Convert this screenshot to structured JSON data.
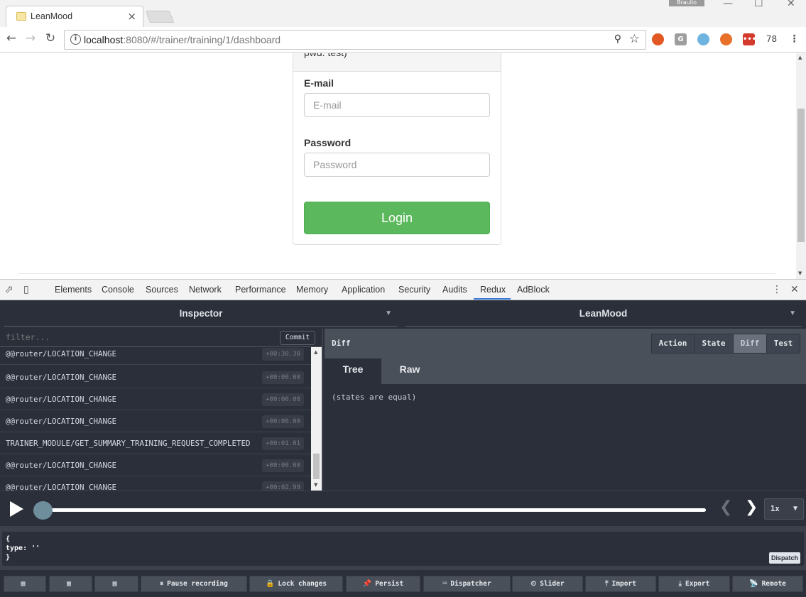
{
  "browser": {
    "tab_title": "LeanMood",
    "tab_close": "×",
    "user_badge": "Braulio",
    "url_host": "localhost",
    "url_rest": ":8080/#/trainer/training/1/dashboard",
    "ext_count": "78",
    "window_controls": [
      "—",
      "☐",
      "✕"
    ]
  },
  "page": {
    "card_header": "pwd: test)",
    "email_label": "E-mail",
    "email_placeholder": "E-mail",
    "password_label": "Password",
    "password_placeholder": "Password",
    "login_label": "Login"
  },
  "devtools": {
    "tabs": [
      "Elements",
      "Console",
      "Sources",
      "Network",
      "Performance",
      "Memory",
      "Application",
      "Security",
      "Audits",
      "Redux",
      "AdBlock"
    ],
    "active_tab": "Redux"
  },
  "redux": {
    "monitor": "Inspector",
    "instance": "LeanMood",
    "filter_placeholder": "filter...",
    "commit_label": "Commit",
    "actions": [
      {
        "name": "@@router/LOCATION_CHANGE",
        "time": "+00:30.30"
      },
      {
        "name": "@@router/LOCATION_CHANGE",
        "time": "+00:00.00"
      },
      {
        "name": "@@router/LOCATION_CHANGE",
        "time": "+00:00.00"
      },
      {
        "name": "@@router/LOCATION_CHANGE",
        "time": "+00:00.00"
      },
      {
        "name": "TRAINER_MODULE/GET_SUMMARY_TRAINING_REQUEST_COMPLETED",
        "time": "+00:01.01"
      },
      {
        "name": "@@router/LOCATION_CHANGE",
        "time": "+00:00.00"
      },
      {
        "name": "@@router/LOCATION_CHANGE",
        "time": "+00:02.99"
      }
    ],
    "panel_title": "Diff",
    "view_buttons": [
      "Action",
      "State",
      "Diff",
      "Test"
    ],
    "active_view": "Diff",
    "subtabs": [
      "Tree",
      "Raw"
    ],
    "active_subtab": "Tree",
    "diff_message": "(states are equal)",
    "slider_position": 0.0,
    "speed": "1x",
    "dispatch_code": "{\ntype: ''\n}",
    "dispatch_label": "Dispatch",
    "toolbar": [
      {
        "label": "",
        "icon": "dock-left-icon"
      },
      {
        "label": "",
        "icon": "dock-right-icon"
      },
      {
        "label": "",
        "icon": "dock-bottom-icon"
      },
      {
        "label": "Pause recording",
        "icon": "pause-icon"
      },
      {
        "label": "Lock changes",
        "icon": "lock-icon"
      },
      {
        "label": "Persist",
        "icon": "pin-icon"
      },
      {
        "label": "Dispatcher",
        "icon": "keyboard-icon"
      },
      {
        "label": "Slider",
        "icon": "history-icon"
      },
      {
        "label": "Import",
        "icon": "upload-icon"
      },
      {
        "label": "Export",
        "icon": "download-icon"
      },
      {
        "label": "Remote",
        "icon": "broadcast-icon"
      }
    ]
  },
  "colors": {
    "login_green": "#5cb85c",
    "redux_bg": "#2a2f3a",
    "devtools_accent": "#3879d9"
  }
}
